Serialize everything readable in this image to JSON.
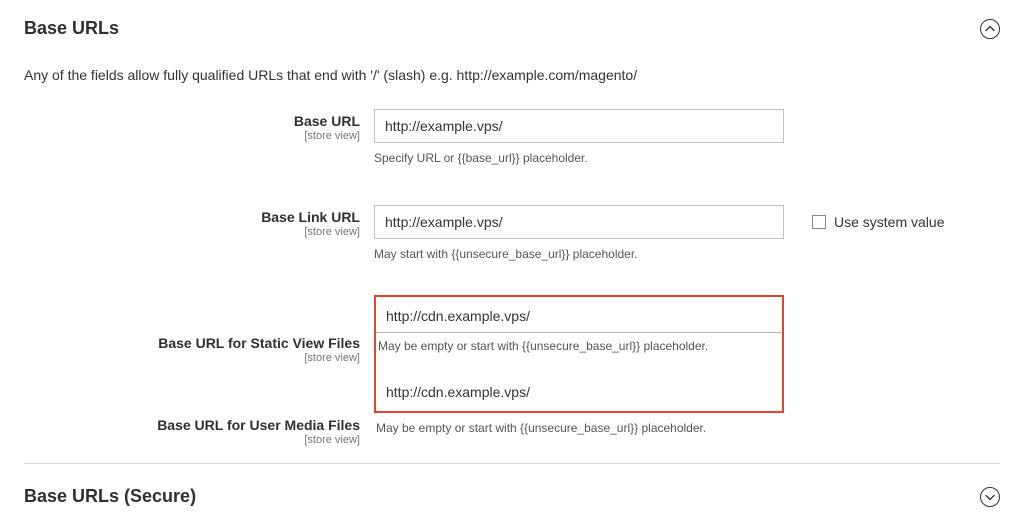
{
  "section1": {
    "title": "Base URLs",
    "description": "Any of the fields allow fully qualified URLs that end with '/' (slash) e.g. http://example.com/magento/",
    "scope_label": "[store view]",
    "use_system_value_label": "Use system value",
    "fields": {
      "base_url": {
        "label": "Base URL",
        "value": "http://example.vps/",
        "hint": "Specify URL or {{base_url}} placeholder."
      },
      "base_link_url": {
        "label": "Base Link URL",
        "value": "http://example.vps/",
        "hint": "May start with {{unsecure_base_url}} placeholder."
      },
      "static_view": {
        "label": "Base URL for Static View Files",
        "value": "http://cdn.example.vps/",
        "hint": "May be empty or start with {{unsecure_base_url}} placeholder."
      },
      "user_media": {
        "label": "Base URL for User Media Files",
        "value": "http://cdn.example.vps/",
        "hint": "May be empty or start with {{unsecure_base_url}} placeholder."
      }
    }
  },
  "section2": {
    "title": "Base URLs (Secure)"
  }
}
